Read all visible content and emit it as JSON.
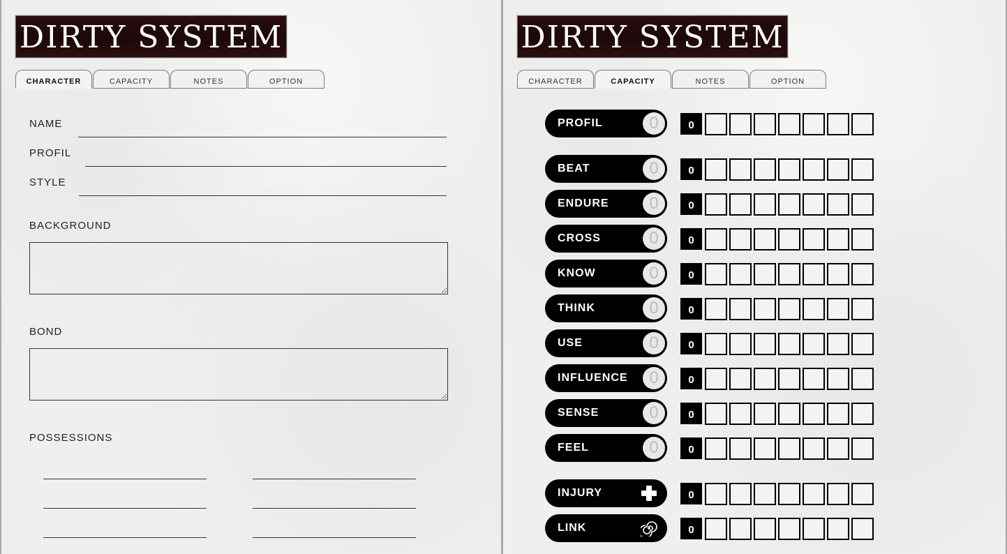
{
  "logo_text": "DIRTY SYSTEM",
  "tabs": [
    "CHARACTER",
    "CAPACITY",
    "NOTES",
    "OPTION"
  ],
  "left": {
    "active_tab": "CHARACTER",
    "fields": {
      "name_label": "NAME",
      "profil_label": "PROFIL",
      "style_label": "STYLE",
      "background_label": "BACKGROUND",
      "bond_label": "BOND",
      "possessions_label": "POSSESSIONS"
    }
  },
  "right": {
    "active_tab": "CAPACITY",
    "stats": [
      {
        "name": "PROFIL",
        "circle": "0",
        "count": "0"
      },
      {
        "name": "BEAT",
        "circle": "0",
        "count": "0"
      },
      {
        "name": "ENDURE",
        "circle": "0",
        "count": "0"
      },
      {
        "name": "CROSS",
        "circle": "0",
        "count": "0"
      },
      {
        "name": "KNOW",
        "circle": "0",
        "count": "0"
      },
      {
        "name": "THINK",
        "circle": "0",
        "count": "0"
      },
      {
        "name": "USE",
        "circle": "0",
        "count": "0"
      },
      {
        "name": "INFLUENCE",
        "circle": "0",
        "count": "0"
      },
      {
        "name": "SENSE",
        "circle": "0",
        "count": "0"
      },
      {
        "name": "FEEL",
        "circle": "0",
        "count": "0"
      },
      {
        "name": "INJURY",
        "icon": "plus-icon",
        "count": "0"
      },
      {
        "name": "LINK",
        "icon": "spiral-icon",
        "count": "0"
      }
    ],
    "checkboxes_per_row": 7
  }
}
